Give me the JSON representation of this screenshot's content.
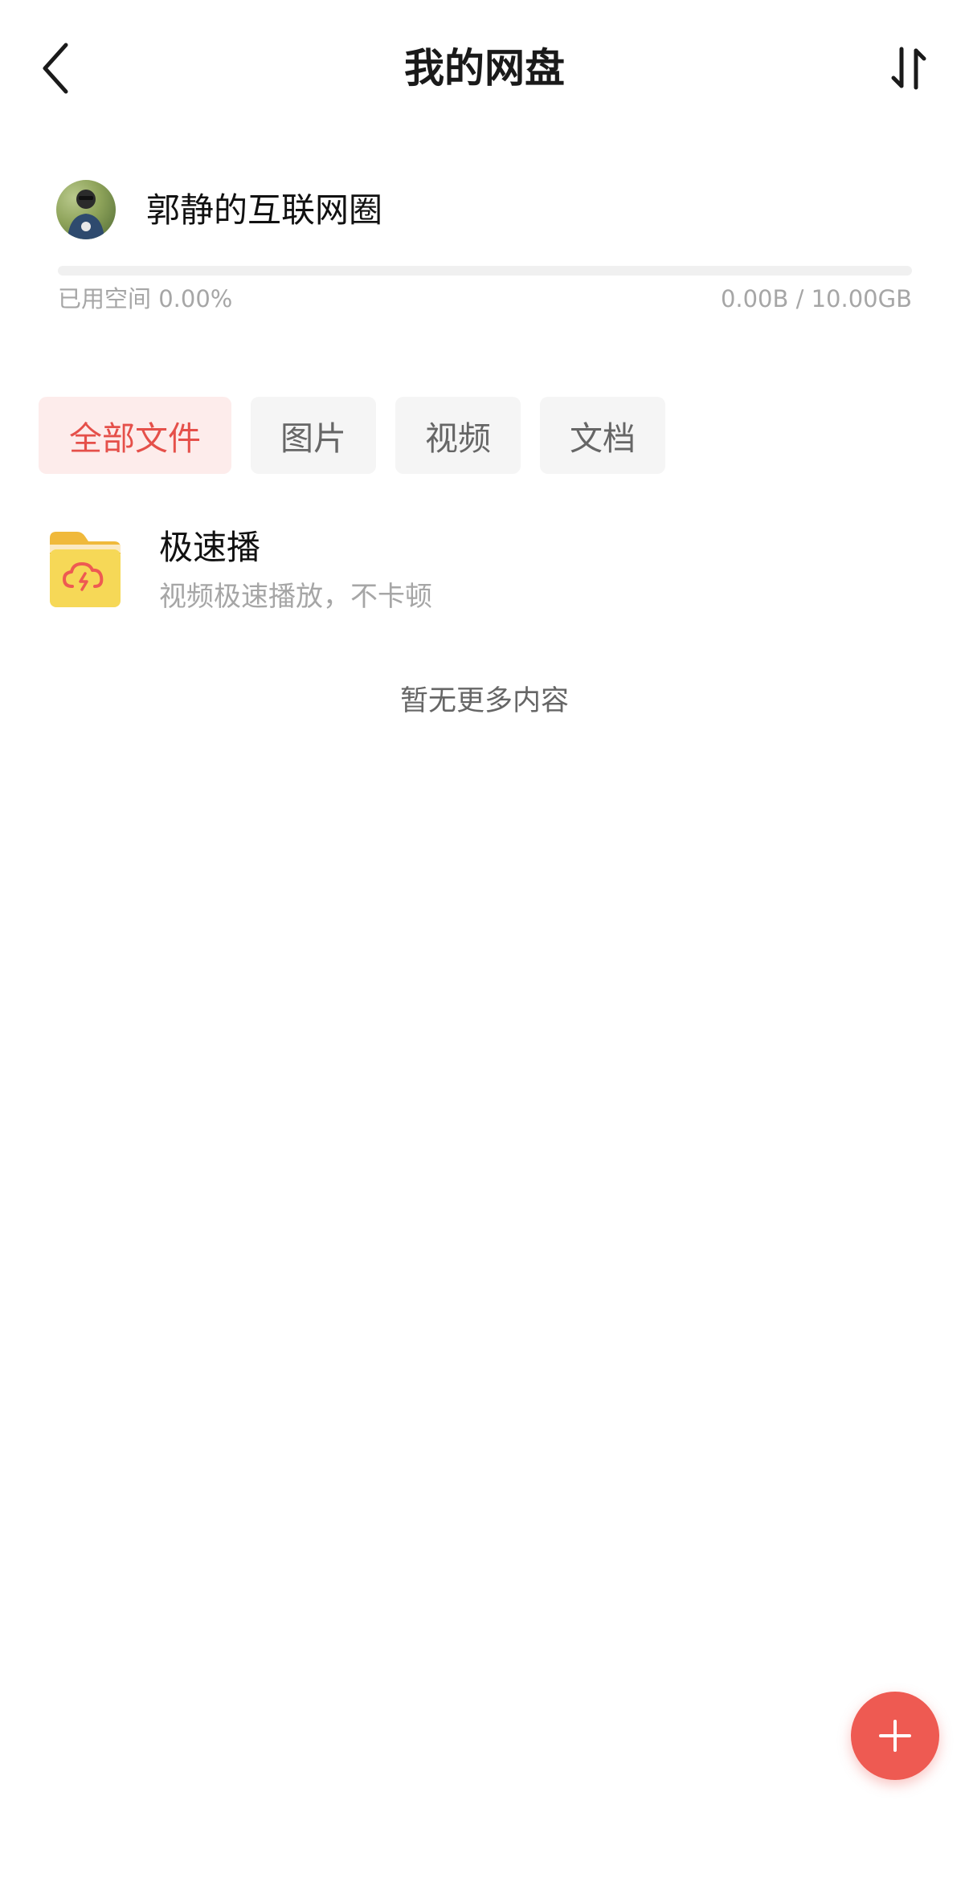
{
  "header": {
    "title": "我的网盘",
    "back_icon": "chevron-left-icon",
    "sort_icon": "sort-icon"
  },
  "profile": {
    "name": "郭静的互联网圈"
  },
  "storage": {
    "used_label": "已用空间 0.00%",
    "capacity": "0.00B / 10.00GB",
    "used_fraction": 0.0
  },
  "tabs": [
    {
      "label": "全部文件",
      "active": true
    },
    {
      "label": "图片",
      "active": false
    },
    {
      "label": "视频",
      "active": false
    },
    {
      "label": "文档",
      "active": false
    }
  ],
  "files": [
    {
      "title": "极速播",
      "subtitle": "视频极速播放，不卡顿",
      "icon": "cloud-folder-icon"
    }
  ],
  "empty_text": "暂无更多内容",
  "fab": {
    "icon": "plus-icon"
  },
  "colors": {
    "accent": "#ee5a52",
    "active_tab_bg": "#fdeceb",
    "folder_yellow": "#f6d857"
  }
}
